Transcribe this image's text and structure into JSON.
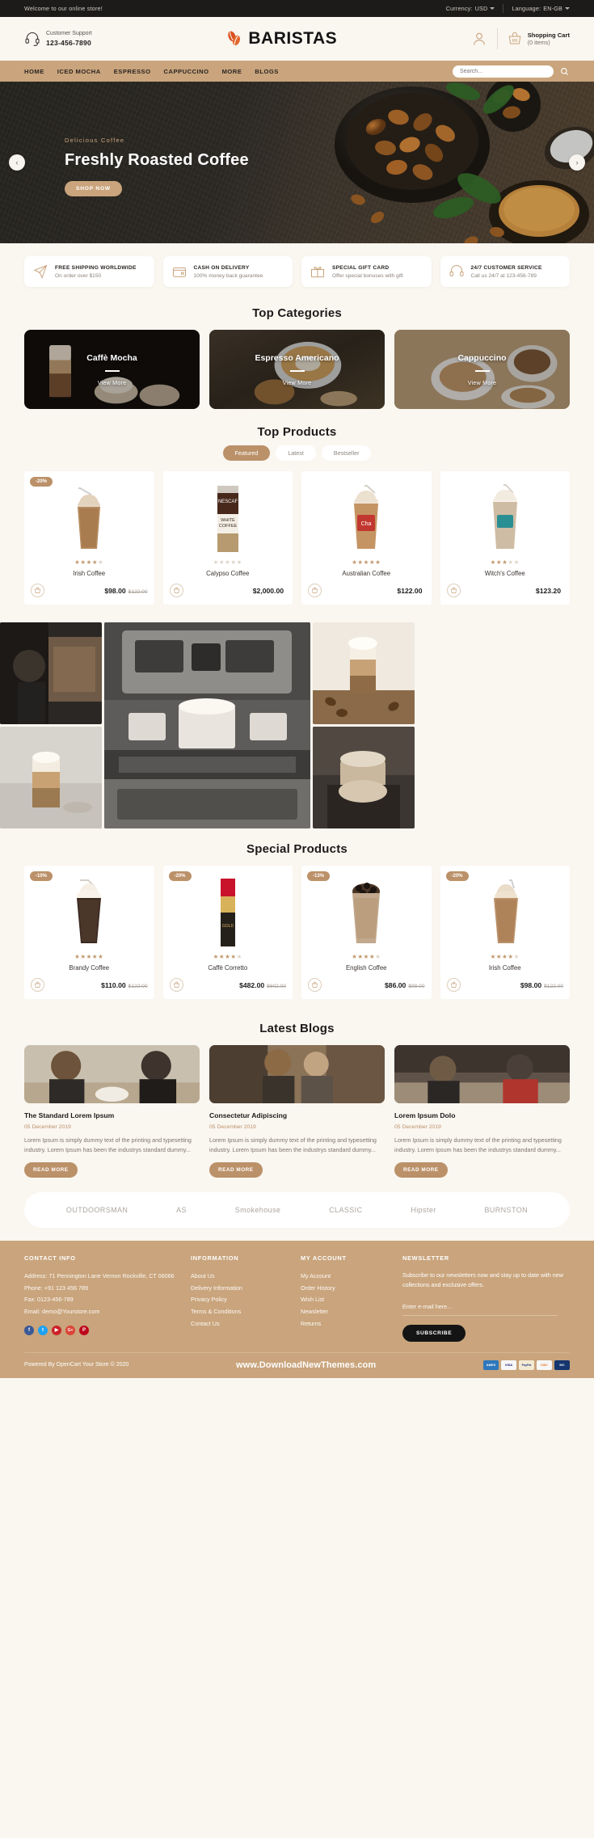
{
  "topbar": {
    "welcome": "Welcome to our online store!",
    "currency_label": "Currency:",
    "currency_value": "USD",
    "language_label": "Language:",
    "language_value": "EN-GB"
  },
  "header": {
    "support_label": "Customer Support",
    "support_phone": "123-456-7890",
    "brand": "BARISTAS",
    "cart_label": "Shopping Cart",
    "cart_items": "(0 items)"
  },
  "nav": {
    "items": [
      {
        "label": "HOME"
      },
      {
        "label": "ICED MOCHA"
      },
      {
        "label": "ESPRESSO"
      },
      {
        "label": "CAPPUCCINO"
      },
      {
        "label": "MORE"
      },
      {
        "label": "BLOGS"
      }
    ],
    "search_placeholder": "Search..."
  },
  "hero": {
    "subtitle": "Delicious Coffee",
    "title": "Freshly Roasted Coffee",
    "button": "SHOP NOW",
    "prev": "‹",
    "next": "›"
  },
  "services": [
    {
      "title": "FREE SHIPPING WORLDWIDE",
      "desc": "On order over $150",
      "icon": "airplane-icon"
    },
    {
      "title": "CASH ON DELIVERY",
      "desc": "100% money back guarantee",
      "icon": "wallet-icon"
    },
    {
      "title": "SPECIAL GIFT CARD",
      "desc": "Offer special bonuses with gift",
      "icon": "gift-icon"
    },
    {
      "title": "24/7 CUSTOMER SERVICE",
      "desc": "Call us 24/7 at 123-456-789",
      "icon": "headset-icon"
    }
  ],
  "categories": {
    "title": "Top Categories",
    "view_more": "View More",
    "items": [
      {
        "name": "Caffè Mocha"
      },
      {
        "name": "Espresso Americano"
      },
      {
        "name": "Cappuccino"
      }
    ]
  },
  "top_products": {
    "title": "Top Products",
    "tabs": [
      {
        "label": "Featured",
        "active": true
      },
      {
        "label": "Latest",
        "active": false
      },
      {
        "label": "Bestseller",
        "active": false
      }
    ],
    "items": [
      {
        "name": "Irish Coffee",
        "price": "$98.00",
        "old_price": "$122.00",
        "rating": 4,
        "badge": "-20%"
      },
      {
        "name": "Calypso Coffee",
        "price": "$2,000.00",
        "old_price": "",
        "rating": 0,
        "badge": ""
      },
      {
        "name": "Australian Coffee",
        "price": "$122.00",
        "old_price": "",
        "rating": 5,
        "badge": ""
      },
      {
        "name": "Witch's Coffee",
        "price": "$123.20",
        "old_price": "",
        "rating": 3,
        "badge": ""
      }
    ]
  },
  "special_products": {
    "title": "Special Products",
    "items": [
      {
        "name": "Brandy Coffee",
        "price": "$110.00",
        "old_price": "$122.00",
        "rating": 5,
        "badge": "-10%"
      },
      {
        "name": "Caffè Corretto",
        "price": "$482.00",
        "old_price": "$602.00",
        "rating": 4,
        "badge": "-20%"
      },
      {
        "name": "English Coffee",
        "price": "$86.00",
        "old_price": "$98.00",
        "rating": 4,
        "badge": "-13%"
      },
      {
        "name": "Irish Coffee",
        "price": "$98.00",
        "old_price": "$122.00",
        "rating": 4,
        "badge": "-20%"
      }
    ]
  },
  "blogs": {
    "title": "Latest Blogs",
    "read_more": "READ MORE",
    "items": [
      {
        "title": "The Standard Lorem Ipsum",
        "date": "05 December 2019",
        "excerpt": "Lorem Ipsum is simply dummy text of the printing and typesetting industry. Lorem Ipsum has been the industrys standard dummy..."
      },
      {
        "title": "Consectetur Adipiscing",
        "date": "05 December 2019",
        "excerpt": "Lorem Ipsum is simply dummy text of the printing and typesetting industry. Lorem Ipsum has been the industrys standard dummy..."
      },
      {
        "title": "Lorem Ipsum Dolo",
        "date": "05 December 2019",
        "excerpt": "Lorem Ipsum is simply dummy text of the printing and typesetting industry. Lorem Ipsum has been the industrys standard dummy..."
      }
    ]
  },
  "brands": [
    {
      "name": "OUTDOORSMAN"
    },
    {
      "name": "AS"
    },
    {
      "name": "Smokehouse"
    },
    {
      "name": "CLASSIC"
    },
    {
      "name": "Hipster"
    },
    {
      "name": "BURNSTON"
    }
  ],
  "footer": {
    "contact": {
      "heading": "CONTACT INFO",
      "address": "Address: 71 Pennington Lane Vernon Rockville, CT 06066",
      "phone": "Phone: +91 123 456 789",
      "fax": "Fax: 0123-456-789",
      "email": "Email: demo@Yourstore.com",
      "socials": [
        {
          "name": "facebook",
          "glyph": "f",
          "color": "#3b5998"
        },
        {
          "name": "twitter",
          "glyph": "t",
          "color": "#1da1f2"
        },
        {
          "name": "youtube",
          "glyph": "▶",
          "color": "#cc2127"
        },
        {
          "name": "google-plus",
          "glyph": "G+",
          "color": "#db4437"
        },
        {
          "name": "pinterest",
          "glyph": "P",
          "color": "#bd081c"
        }
      ]
    },
    "information": {
      "heading": "INFORMATION",
      "links": [
        "About Us",
        "Delivery Information",
        "Privacy Policy",
        "Terms & Conditions",
        "Contact Us"
      ]
    },
    "account": {
      "heading": "MY ACCOUNT",
      "links": [
        "My Account",
        "Order History",
        "Wish List",
        "Newsletter",
        "Returns"
      ]
    },
    "newsletter": {
      "heading": "NEWSLETTER",
      "text": "Subscribe to our newsletters now and stay up to date with new collections and exclusive offers.",
      "placeholder": "Enter e-mail here...",
      "button": "SUBSCRIBE"
    },
    "bottom": {
      "copyright": "Powered By OpenCart Your Store © 2020",
      "promo": "www.DownloadNewThemes.com",
      "payments": [
        {
          "name": "American Express",
          "short": "AMEX",
          "color": "#2e77bc"
        },
        {
          "name": "Visa",
          "short": "VISA",
          "color": "#f7f7f7"
        },
        {
          "name": "PayPal",
          "short": "PayPal",
          "color": "#f4ead3"
        },
        {
          "name": "Discover",
          "short": "DISC",
          "color": "#f7f7f7"
        },
        {
          "name": "MasterCard",
          "short": "MC",
          "color": "#16366f"
        }
      ]
    }
  },
  "colors": {
    "accent": "#c9a47c",
    "accent_dark": "#bb9169",
    "dark": "#1d1b1a",
    "page_bg": "#faf6f0"
  }
}
